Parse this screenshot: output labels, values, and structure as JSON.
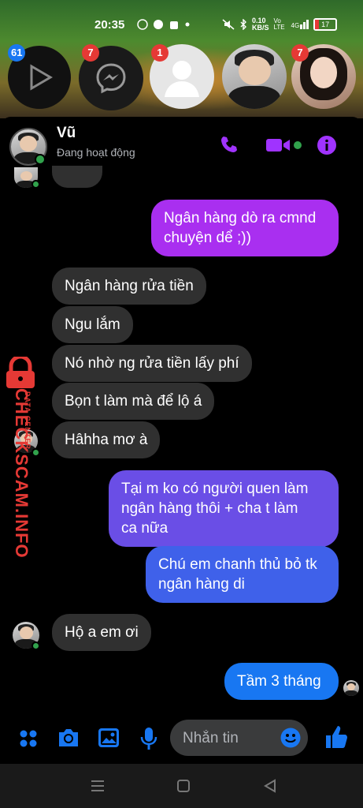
{
  "status_bar": {
    "time": "20:35",
    "network_speed": "0.10\nKB/S",
    "volte": "Vo LTE",
    "signal": "4G",
    "battery": "17",
    "battery_level": 0.17
  },
  "bubble_heads": [
    {
      "name": "play",
      "badge": "61",
      "badge_color": "#1877f2"
    },
    {
      "name": "messenger",
      "badge": "7",
      "badge_color": "#e53935"
    },
    {
      "name": "default-avatar",
      "badge": "1",
      "badge_color": "#e53935"
    },
    {
      "name": "male-avatar",
      "badge": ""
    },
    {
      "name": "female-avatar",
      "badge": "7",
      "badge_color": "#e53935"
    }
  ],
  "header": {
    "name": "Vũ",
    "status": "Đang hoạt động"
  },
  "messages": [
    {
      "from": "me",
      "text_lines": [
        "Ngân hàng dò ra cmnd",
        "chuyện dể ;))"
      ]
    },
    {
      "from": "them",
      "text": "Ngân hàng rửa tiền"
    },
    {
      "from": "them",
      "text": "Ngu lắm"
    },
    {
      "from": "them",
      "text": "Nó nhờ ng rửa tiền lấy phí"
    },
    {
      "from": "them",
      "text": "Bọn t làm mà để lộ á"
    },
    {
      "from": "them",
      "text": "Hâhha mơ à"
    },
    {
      "from": "me",
      "text_lines": [
        "Tại m ko có người quen làm",
        "ngân hàng thôi + cha t làm",
        "ca nữa"
      ]
    },
    {
      "from": "me",
      "text_lines": [
        "Chú em chanh thủ bỏ tk",
        "ngân hàng di"
      ]
    },
    {
      "from": "them",
      "text": "Hộ a em ơi"
    },
    {
      "from": "me",
      "text": "Tầm 3 tháng"
    }
  ],
  "composer": {
    "placeholder": "Nhắn tin"
  },
  "watermark": {
    "brand": "CHECKSCAM.INFO",
    "sub": "DATA CENTER"
  },
  "colors": {
    "accent": "#a033ff",
    "bubble_in": "#303030",
    "online": "#31a24c",
    "send_blue": "#1877f2"
  }
}
